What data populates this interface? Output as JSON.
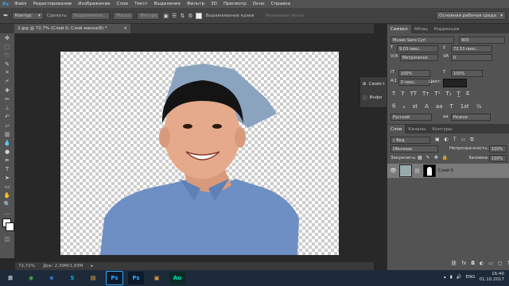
{
  "app": {
    "logo": "Ps"
  },
  "menu": [
    "Файл",
    "Редактирование",
    "Изображение",
    "Слои",
    "Текст",
    "Выделение",
    "Фильтр",
    "3D",
    "Просмотр",
    "Окно",
    "Справка"
  ],
  "options": {
    "mode": "Контур",
    "make_label": "Сделать:",
    "selection": "Выделенная...",
    "mask": "Маска",
    "shape": "Фигура",
    "align_label": "Выравнивание краев",
    "rubber": "Резиновая лента",
    "workspace": "Основная рабочая среда"
  },
  "document": {
    "tab_title": "2.jpg @ 72,7% (Слой 0, Слой-маска/8) *",
    "close": "×"
  },
  "status": {
    "zoom": "72,72%",
    "doc": "Док: 2,39М/1,93М"
  },
  "collapsed_panels": [
    {
      "label": "Свойст...",
      "icon": "properties-icon"
    },
    {
      "label": "Инфо",
      "icon": "info-icon"
    }
  ],
  "char_panel": {
    "tabs": [
      "Символ",
      "Абзац",
      "Коррекция"
    ],
    "font": "Museo Sans Cyrl",
    "style": "900",
    "size": "9,03 пикс.",
    "leading": "72,53 пикс.",
    "kerning": "Метрически",
    "tracking": "0",
    "vscale": "100%",
    "hscale": "100%",
    "baseline": "0 пикс.",
    "color_label": "Цвет:",
    "language": "Русский",
    "aa_label": "aa",
    "aa": "Резкое"
  },
  "layers_panel": {
    "tabs": [
      "Слои",
      "Каналы",
      "Контуры"
    ],
    "filter": "Вид",
    "blend": "Обычные",
    "opacity_label": "Непрозрачность:",
    "opacity": "100%",
    "lock_label": "Закрепить:",
    "fill_label": "Заливка:",
    "fill": "100%",
    "layer_name": "Слой 0"
  },
  "taskbar": {
    "apps": [
      {
        "label": "◉",
        "color": "#4caf50"
      },
      {
        "label": "e",
        "color": "#3d8ee6"
      },
      {
        "label": "S",
        "color": "#00aff0"
      },
      {
        "label": "▤",
        "color": "#f0c040"
      },
      {
        "label": "Ps",
        "color": "#31a8ff"
      },
      {
        "label": "Ps",
        "color": "#31a8ff"
      },
      {
        "label": "▣",
        "color": "#e8a04c"
      },
      {
        "label": "Au",
        "color": "#00e4bb"
      }
    ],
    "lang": "ENG",
    "time": "16:40",
    "date": "01.10.2017"
  }
}
